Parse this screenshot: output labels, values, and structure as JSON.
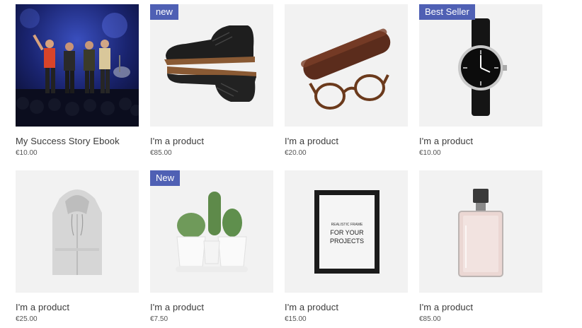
{
  "products": [
    {
      "name": "My Success Story Ebook",
      "price": "€10.00",
      "badge": "",
      "image": "concert-photo"
    },
    {
      "name": "I'm a product",
      "price": "€85.00",
      "badge": "new",
      "image": "leather-boots"
    },
    {
      "name": "I'm a product",
      "price": "€20.00",
      "badge": "",
      "image": "glasses-and-case"
    },
    {
      "name": "I'm a product",
      "price": "€10.00",
      "badge": "Best Seller",
      "image": "wrist-watch"
    },
    {
      "name": "I'm a product",
      "price": "€25.00",
      "badge": "",
      "image": "grey-hoodie"
    },
    {
      "name": "I'm a product",
      "price": "€7.50",
      "badge": "New",
      "image": "cactus-planter"
    },
    {
      "name": "I'm a product",
      "price": "€15.00",
      "badge": "",
      "image": "picture-frame"
    },
    {
      "name": "I'm a product",
      "price": "€85.00",
      "badge": "",
      "image": "perfume-bottle"
    }
  ],
  "frame_poster": {
    "line1": "REALISTIC FRAME",
    "line2": "FOR YOUR",
    "line3": "PROJECTS"
  },
  "colors": {
    "badge_bg": "#4f60b4",
    "thumb_bg": "#f2f2f2"
  }
}
